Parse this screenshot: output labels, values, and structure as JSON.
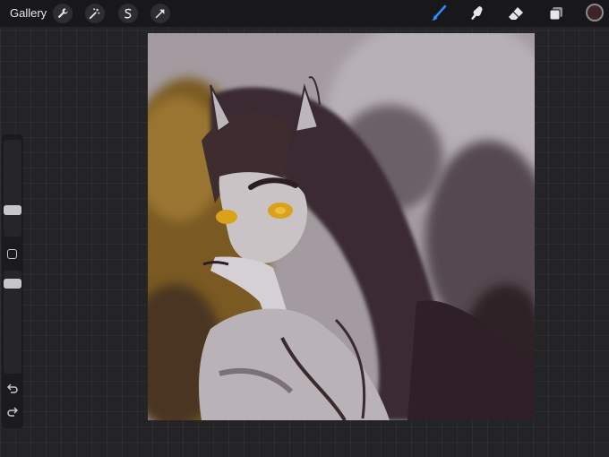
{
  "toolbar": {
    "gallery_label": "Gallery",
    "left_tools": [
      "wrench-icon",
      "magic-wand-icon",
      "selection-icon",
      "transform-arrow-icon"
    ],
    "right_tools": [
      "brush-icon",
      "smudge-icon",
      "eraser-icon",
      "layers-icon"
    ],
    "active_tool": "brush-icon",
    "accent": "#2d8cff",
    "current_color": "#3a2428"
  },
  "sidebar": {
    "brush_size": 0.5,
    "opacity": 0.9,
    "controls": [
      "modify-square-icon",
      "undo-icon",
      "redo-icon"
    ]
  },
  "canvas": {
    "palette": [
      "#a39ba0",
      "#3a2a30",
      "#7a5a22",
      "#d9a21a",
      "#c9c3c6"
    ]
  }
}
